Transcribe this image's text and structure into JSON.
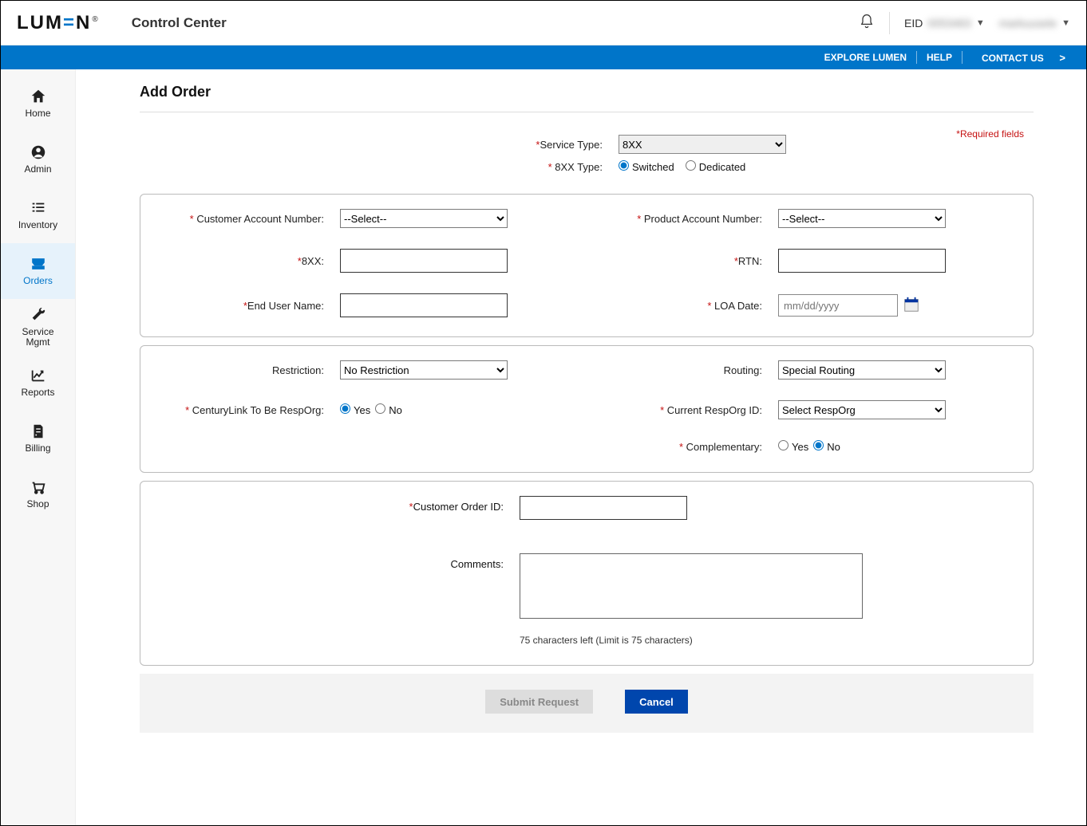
{
  "header": {
    "logo_text": "LUMEN",
    "app_title": "Control Center",
    "eid_label": "EID",
    "eid_value": "0053463",
    "username": "markuusele"
  },
  "subnav": {
    "explore": "EXPLORE LUMEN",
    "help": "HELP",
    "contact": "CONTACT US"
  },
  "sidebar": {
    "home": "Home",
    "admin": "Admin",
    "inventory": "Inventory",
    "orders": "Orders",
    "service": "Service\nMgmt",
    "reports": "Reports",
    "billing": "Billing",
    "shop": "Shop"
  },
  "page": {
    "title": "Add Order",
    "required_fields": "Required fields"
  },
  "form_top": {
    "service_type_label": "Service Type:",
    "service_type_value": "8XX",
    "eightxx_type_label": "8XX Type:",
    "switched": "Switched",
    "dedicated": "Dedicated"
  },
  "panel1": {
    "cust_acct_label": "Customer Account Number:",
    "cust_acct_value": "--Select--",
    "prod_acct_label": "Product Account Number:",
    "prod_acct_value": "--Select--",
    "eightxx_label": "8XX:",
    "rtn_label": "RTN:",
    "end_user_label": "End User Name:",
    "loa_date_label": "LOA Date:",
    "loa_date_placeholder": "mm/dd/yyyy"
  },
  "panel2": {
    "restriction_label": "Restriction:",
    "restriction_value": "No Restriction",
    "routing_label": "Routing:",
    "routing_value": "Special Routing",
    "resporg_label": "CenturyLink To Be RespOrg:",
    "yes": "Yes",
    "no": "No",
    "current_resporg_label": "Current RespOrg ID:",
    "current_resporg_value": "Select RespOrg",
    "complementary_label": "Complementary:"
  },
  "panel3": {
    "cust_order_id_label": "Customer Order ID:",
    "comments_label": "Comments:",
    "char_hint": "75 characters left (Limit is 75 characters)"
  },
  "footer": {
    "submit": "Submit Request",
    "cancel": "Cancel"
  }
}
